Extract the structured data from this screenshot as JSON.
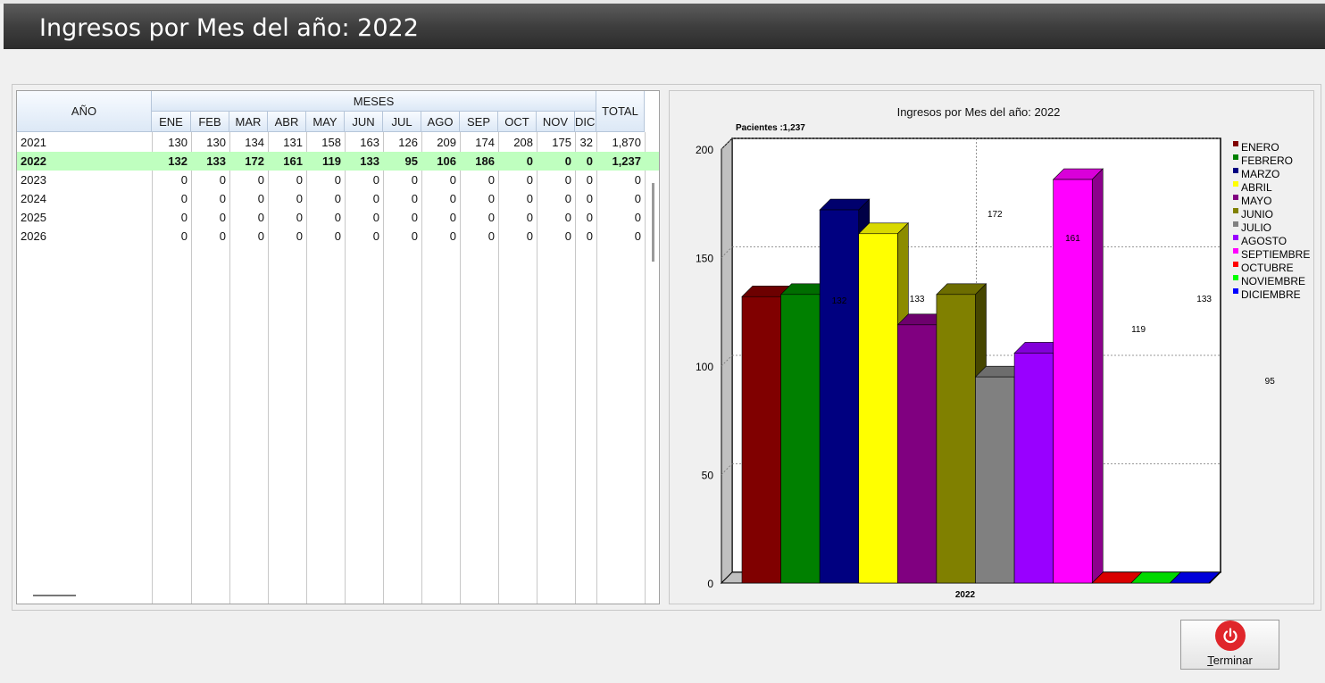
{
  "window": {
    "title": "Ingresos por Mes del año: 2022"
  },
  "grid": {
    "year_header": "AÑO",
    "group_header": "MESES",
    "total_header": "TOTAL",
    "months": [
      "ENE",
      "FEB",
      "MAR",
      "ABR",
      "MAY",
      "JUN",
      "JUL",
      "AGO",
      "SEP",
      "OCT",
      "NOV",
      "DIC"
    ],
    "rows": [
      {
        "year": "2021",
        "values": [
          "130",
          "130",
          "134",
          "131",
          "158",
          "163",
          "126",
          "209",
          "174",
          "208",
          "175",
          "32"
        ],
        "total": "1,870",
        "selected": false
      },
      {
        "year": "2022",
        "values": [
          "132",
          "133",
          "172",
          "161",
          "119",
          "133",
          "95",
          "106",
          "186",
          "0",
          "0",
          "0"
        ],
        "total": "1,237",
        "selected": true
      },
      {
        "year": "2023",
        "values": [
          "0",
          "0",
          "0",
          "0",
          "0",
          "0",
          "0",
          "0",
          "0",
          "0",
          "0",
          "0"
        ],
        "total": "0",
        "selected": false
      },
      {
        "year": "2024",
        "values": [
          "0",
          "0",
          "0",
          "0",
          "0",
          "0",
          "0",
          "0",
          "0",
          "0",
          "0",
          "0"
        ],
        "total": "0",
        "selected": false
      },
      {
        "year": "2025",
        "values": [
          "0",
          "0",
          "0",
          "0",
          "0",
          "0",
          "0",
          "0",
          "0",
          "0",
          "0",
          "0"
        ],
        "total": "0",
        "selected": false
      },
      {
        "year": "2026",
        "values": [
          "0",
          "0",
          "0",
          "0",
          "0",
          "0",
          "0",
          "0",
          "0",
          "0",
          "0",
          "0"
        ],
        "total": "0",
        "selected": false
      }
    ]
  },
  "chart_data": {
    "type": "bar",
    "title": "Ingresos por Mes del año: 2022",
    "subtitle": "Pacientes :1,237",
    "categories": [
      "2022"
    ],
    "ylim": [
      0,
      200
    ],
    "yticks": [
      0,
      50,
      100,
      150,
      200
    ],
    "grid": true,
    "legend_placement": "right",
    "series": [
      {
        "name": "ENERO",
        "value": 132,
        "color": "#800000"
      },
      {
        "name": "FEBRERO",
        "value": 133,
        "color": "#008000"
      },
      {
        "name": "MARZO",
        "value": 172,
        "color": "#000080"
      },
      {
        "name": "ABRIL",
        "value": 161,
        "color": "#ffff00"
      },
      {
        "name": "MAYO",
        "value": 119,
        "color": "#800080"
      },
      {
        "name": "JUNIO",
        "value": 133,
        "color": "#808000"
      },
      {
        "name": "JULIO",
        "value": 95,
        "color": "#808080"
      },
      {
        "name": "AGOSTO",
        "value": 106,
        "color": "#9900ff"
      },
      {
        "name": "SEPTIEMBRE",
        "value": 186,
        "color": "#ff00ff"
      },
      {
        "name": "OCTUBRE",
        "value": 0,
        "color": "#ff0000"
      },
      {
        "name": "NOVIEMBRE",
        "value": 0,
        "color": "#00ff00"
      },
      {
        "name": "DICIEMBRE",
        "value": 0,
        "color": "#0000ff"
      }
    ],
    "data_labels": [
      {
        "text": "132",
        "series": "MARZO"
      },
      {
        "text": "133",
        "series": "MAYO"
      },
      {
        "text": "172",
        "series": "JULIO"
      },
      {
        "text": "161",
        "series": "SEPTIEMBRE"
      },
      {
        "text": "119",
        "series": "OCTUBRE"
      },
      {
        "text": "133",
        "series": "NOVIEMBRE"
      },
      {
        "text": "95",
        "series": "DICIEMBRE"
      }
    ]
  },
  "button": {
    "label_first": "T",
    "label_rest": "erminar",
    "icon": "power-icon",
    "color": "#e0262b"
  }
}
